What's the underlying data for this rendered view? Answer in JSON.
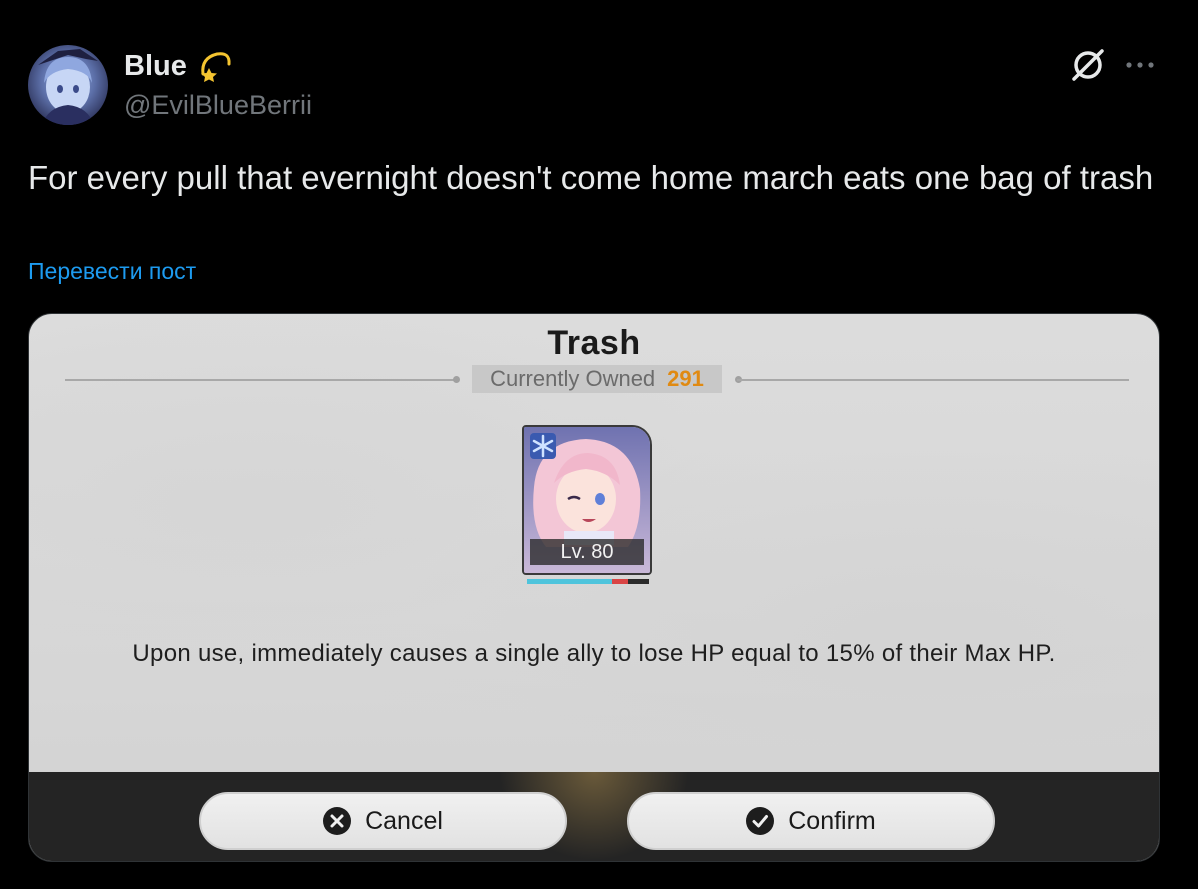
{
  "author": {
    "display_name": "Blue",
    "name_emoji": "dizzy-star-emoji",
    "handle": "@EvilBlueBerrii",
    "avatar": "anime-avatar"
  },
  "header_icons": {
    "grok": "grok-icon",
    "more": "more-icon"
  },
  "post": {
    "text": "For every pull that evernight doesn't come home march eats one bag of trash",
    "translate_label": "Перевести пост"
  },
  "media": {
    "item_title": "Trash",
    "owned_label": "Currently Owned",
    "owned_count": "291",
    "item_level": "Lv. 80",
    "hp_fraction": 0.7,
    "hp_loss_fraction": 0.13,
    "description": "Upon use, immediately causes a single ally to lose HP equal to 15% of their Max HP.",
    "cancel_label": "Cancel",
    "confirm_label": "Confirm"
  },
  "colors": {
    "background": "#000000",
    "text": "#e7e9ea",
    "handle": "#71767b",
    "link": "#1d9bf0",
    "owned_count": "#e08a12",
    "hp_fill": "#4fc4dc",
    "hp_loss": "#d94545"
  }
}
